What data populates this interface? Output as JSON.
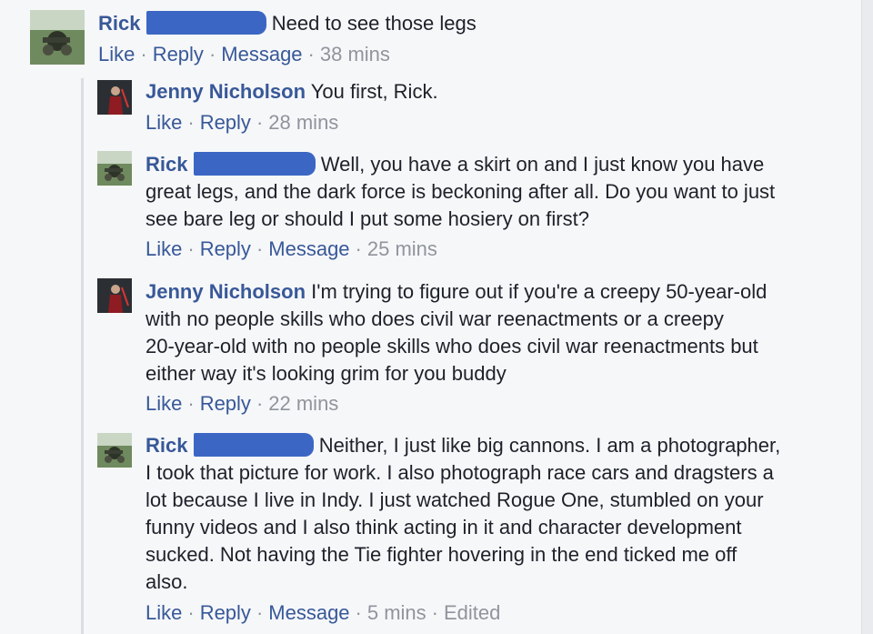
{
  "comments": [
    {
      "author": "Rick",
      "text": " Need to see those legs",
      "actions": {
        "like": "Like",
        "reply": "Reply",
        "message": "Message",
        "time": "38 mins"
      }
    },
    {
      "author": "Jenny Nicholson",
      "text": " You first, Rick.",
      "actions": {
        "like": "Like",
        "reply": "Reply",
        "time": "28 mins"
      }
    },
    {
      "author": "Rick",
      "text_line1": " Well, you have a skirt on and I just know you have",
      "text_line2": "great legs, and the dark force is beckoning after all. Do you want to just",
      "text_line3": "see bare leg or should I put some hosiery on first?",
      "actions": {
        "like": "Like",
        "reply": "Reply",
        "message": "Message",
        "time": "25 mins"
      }
    },
    {
      "author": "Jenny Nicholson",
      "text_line1": " I'm trying to figure out if you're a creepy 50-year-old",
      "text_line2": "with no people skills who does civil war reenactments or a creepy",
      "text_line3": "20-year-old with no people skills who does civil war reenactments but",
      "text_line4": "either way it's looking grim for you buddy",
      "actions": {
        "like": "Like",
        "reply": "Reply",
        "time": "22 mins"
      }
    },
    {
      "author": "Rick",
      "text_line1": " Neither, I just like big cannons. I am a photographer,",
      "text_line2": "I took that picture for work. I also photograph race cars and dragsters a",
      "text_line3": "lot because I live in Indy. I just watched Rogue One, stumbled on your",
      "text_line4": "funny videos and I also think acting in it and character development",
      "text_line5": "sucked. Not having the Tie fighter hovering in the end ticked me off",
      "text_line6": "also.",
      "actions": {
        "like": "Like",
        "reply": "Reply",
        "message": "Message",
        "time": "5 mins",
        "edited": "Edited"
      }
    }
  ],
  "colors": {
    "link": "#385898",
    "meta": "#90949c",
    "redaction": "#3b66c4"
  }
}
